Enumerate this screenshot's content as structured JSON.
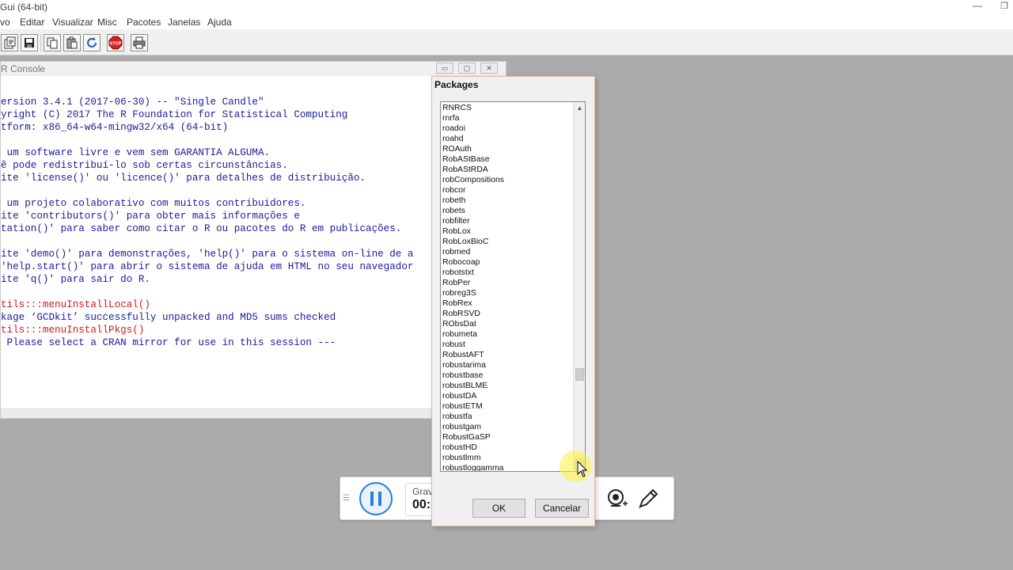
{
  "window": {
    "title": "Gui (64-bit)",
    "min_glyph": "—",
    "restore_glyph": "❐"
  },
  "menu": [
    "vo",
    "Editar",
    "Visualizar",
    "Misc",
    "Pacotes",
    "Janelas",
    "Ajuda"
  ],
  "toolbar": {
    "buttons": [
      "open-script-icon",
      "save-icon",
      "copy-icon",
      "paste-icon",
      "refresh-icon",
      "stop-icon",
      "print-icon"
    ],
    "stop_label": "STOP"
  },
  "console": {
    "title": "R Console",
    "minimize": "▭",
    "maximize": "▢",
    "close": "✕",
    "lines": [
      {
        "text": "ersion 3.4.1 (2017-06-30) -- \"Single Candle\"",
        "color": "blue"
      },
      {
        "text": "yright (C) 2017 The R Foundation for Statistical Computing",
        "color": "blue"
      },
      {
        "text": "tform: x86_64-w64-mingw32/x64 (64-bit)",
        "color": "blue"
      },
      {
        "text": "",
        "color": "blue"
      },
      {
        "text": " um software livre e vem sem GARANTIA ALGUMA.",
        "color": "blue"
      },
      {
        "text": "ê pode redistribuí-lo sob certas circunstâncias.",
        "color": "blue"
      },
      {
        "text": "ite 'license()' ou 'licence()' para detalhes de distribuição.",
        "color": "blue"
      },
      {
        "text": "",
        "color": "blue"
      },
      {
        "text": " um projeto colaborativo com muitos contribuidores.",
        "color": "blue"
      },
      {
        "text": "ite 'contributors()' para obter mais informações e",
        "color": "blue"
      },
      {
        "text": "tation()' para saber como citar o R ou pacotes do R em publicações.",
        "color": "blue"
      },
      {
        "text": "",
        "color": "blue"
      },
      {
        "text": "ite 'demo()' para demonstrações, 'help()' para o sistema on-line de a",
        "color": "blue"
      },
      {
        "text": "'help.start()' para abrir o sistema de ajuda em HTML no seu navegador",
        "color": "blue"
      },
      {
        "text": "ite 'q()' para sair do R.",
        "color": "blue"
      },
      {
        "text": "",
        "color": "blue"
      },
      {
        "text": "tils:::menuInstallLocal()",
        "color": "red"
      },
      {
        "text": "kage ‘GCDkit’ successfully unpacked and MD5 sums checked",
        "color": "blue"
      },
      {
        "text": "tils:::menuInstallPkgs()",
        "color": "red"
      },
      {
        "text": " Please select a CRAN mirror for use in this session ---",
        "color": "blue"
      }
    ]
  },
  "recorder": {
    "label": "Grav",
    "time": "00:"
  },
  "packages_dialog": {
    "title": "Packages",
    "items": [
      "RNRCS",
      "rnrfa",
      "roadoi",
      "roahd",
      "ROAuth",
      "RobAStBase",
      "RobAStRDA",
      "robCompositions",
      "robcor",
      "robeth",
      "robets",
      "robfilter",
      "RobLox",
      "RobLoxBioC",
      "robmed",
      "Robocoap",
      "robotstxt",
      "RobPer",
      "robreg3S",
      "RobRex",
      "RobRSVD",
      "RObsDat",
      "robumeta",
      "robust",
      "RobustAFT",
      "robustarima",
      "robustbase",
      "robustBLME",
      "robustDA",
      "robustETM",
      "robustfa",
      "robustgam",
      "RobustGaSP",
      "robustHD",
      "robustlmm",
      "robustloggamma"
    ],
    "ok": "OK",
    "cancel": "Cancelar",
    "scroll_up": "▲",
    "scroll_down": "▼"
  }
}
